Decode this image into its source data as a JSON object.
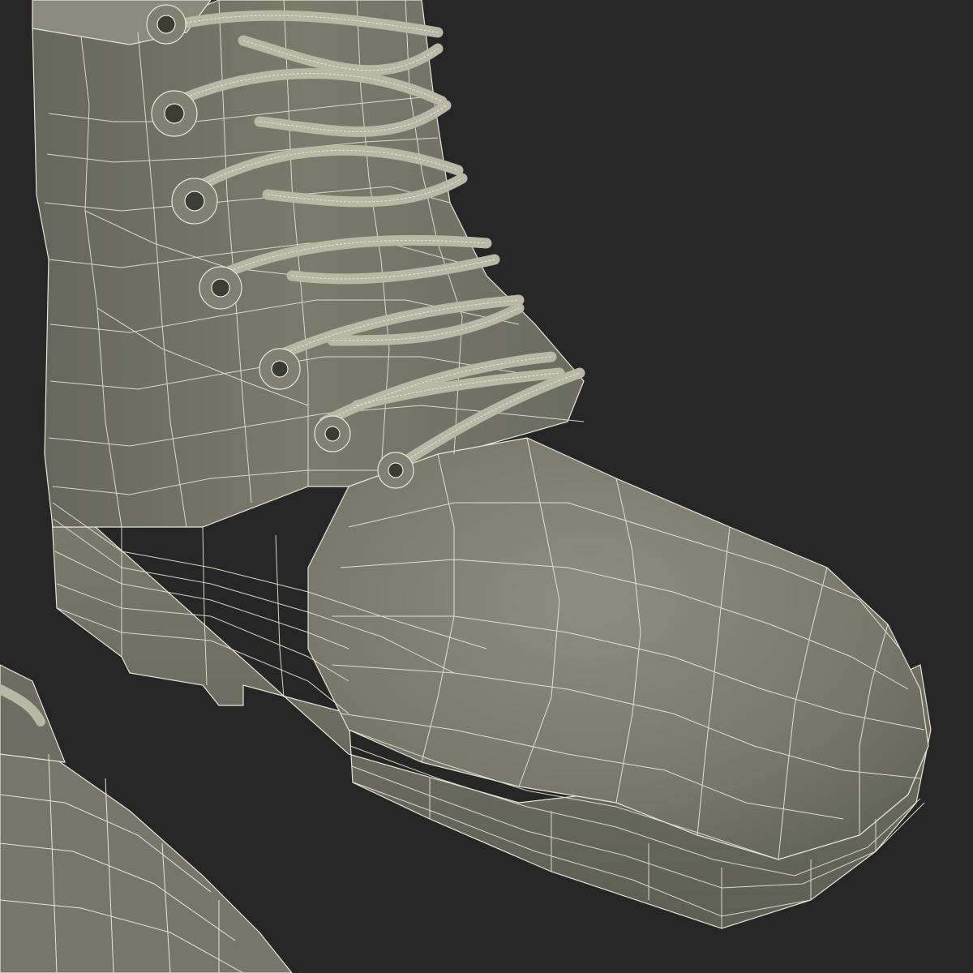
{
  "scene": {
    "subject": "wireframe-boot-render",
    "colors": {
      "background": "#262626",
      "shell": "#777869",
      "shell_light": "#8a8b7c",
      "shell_dark": "#5b5c50",
      "wire": "#e7e6d6",
      "lace": "#b9b8a6"
    }
  }
}
